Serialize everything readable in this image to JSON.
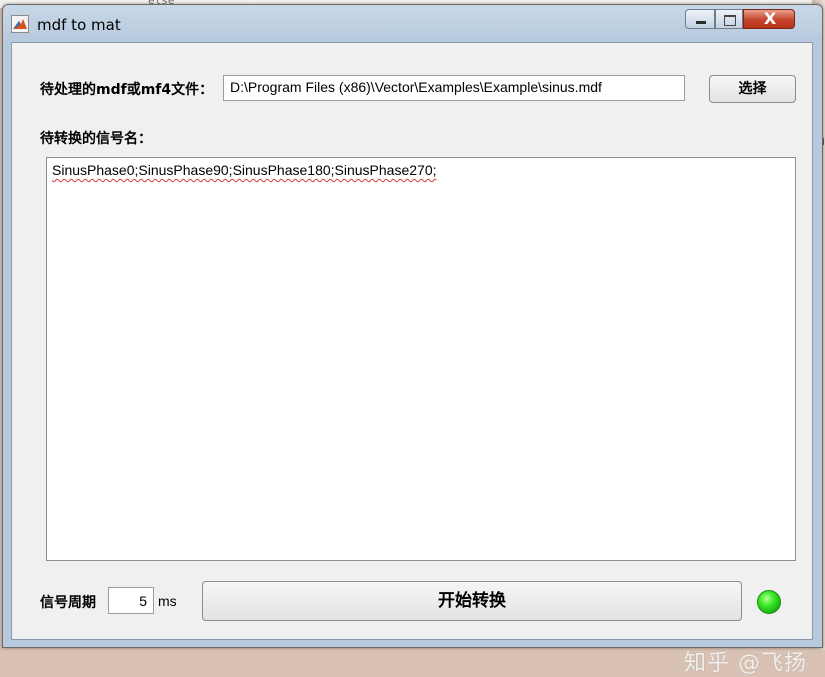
{
  "window": {
    "title": "mdf to mat",
    "close_glyph": "X"
  },
  "background": {
    "code_fragment": "else",
    "right_edge_text": "h"
  },
  "file_section": {
    "label": "待处理的mdf或mf4文件：",
    "path_value": "D:\\Program Files (x86)\\Vector\\Examples\\Example\\sinus.mdf",
    "choose_button": "选择"
  },
  "signals_section": {
    "label": "待转换的信号名：",
    "value": "SinusPhase0;SinusPhase90;SinusPhase180;SinusPhase270;"
  },
  "period_section": {
    "label": "信号周期",
    "value": "5",
    "unit": "ms"
  },
  "start_button": "开始转换",
  "status_lamp": {
    "color": "#33dd22",
    "state": "green"
  },
  "watermark": "知乎 @飞扬",
  "icons": [
    "matlab-icon",
    "minimize-icon",
    "maximize-icon",
    "close-icon"
  ]
}
